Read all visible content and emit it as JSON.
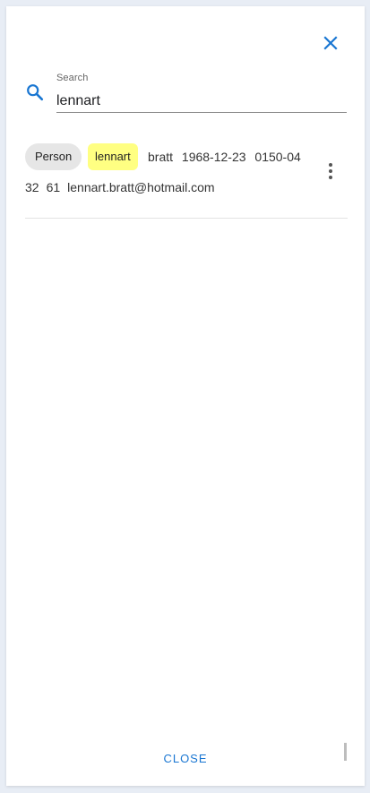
{
  "dialog": {
    "search": {
      "label": "Search",
      "value": "lennart"
    },
    "result": {
      "type_chip": "Person",
      "highlight": "lennart",
      "line1": "bratt 1968-12-23 0150-04",
      "line2_parts": [
        "32",
        "61",
        "lennart.bratt@hotmail.com"
      ]
    },
    "close_label": "CLOSE"
  },
  "icons": {
    "close": "close-icon",
    "search": "search-icon",
    "more": "more-vert-icon"
  },
  "colors": {
    "accent": "#1976d2",
    "highlight": "#ffff82",
    "chip": "#e6e6e6"
  }
}
